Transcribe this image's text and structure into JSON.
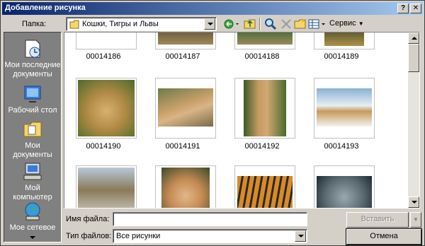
{
  "window": {
    "title": "Добавление рисунка",
    "help_button": "?",
    "close_button": "✕"
  },
  "folder": {
    "label": "Папка:",
    "value": "Кошки, Тигры и Львы"
  },
  "toolbar": {
    "tools_label": "Сервис"
  },
  "places": [
    {
      "label_line1": "Мои последние",
      "label_line2": "документы"
    },
    {
      "label_line1": "Рабочий стол",
      "label_line2": ""
    },
    {
      "label_line1": "Мои",
      "label_line2": "документы"
    },
    {
      "label_line1": "Мой",
      "label_line2": "компьютер"
    },
    {
      "label_line1": "Мое сетевое",
      "label_line2": ""
    }
  ],
  "files": {
    "row1": [
      "00014186",
      "00014187",
      "00014188",
      "00014189"
    ],
    "row2": [
      "00014190",
      "00014191",
      "00014192",
      "00014193"
    ],
    "row3": [
      "",
      "",
      "",
      ""
    ]
  },
  "filename": {
    "label": "Имя файла:",
    "value": ""
  },
  "filetype": {
    "label": "Тип файлов:",
    "value": "Все рисунки"
  },
  "buttons": {
    "insert": "Вставить",
    "cancel": "Отмена"
  }
}
